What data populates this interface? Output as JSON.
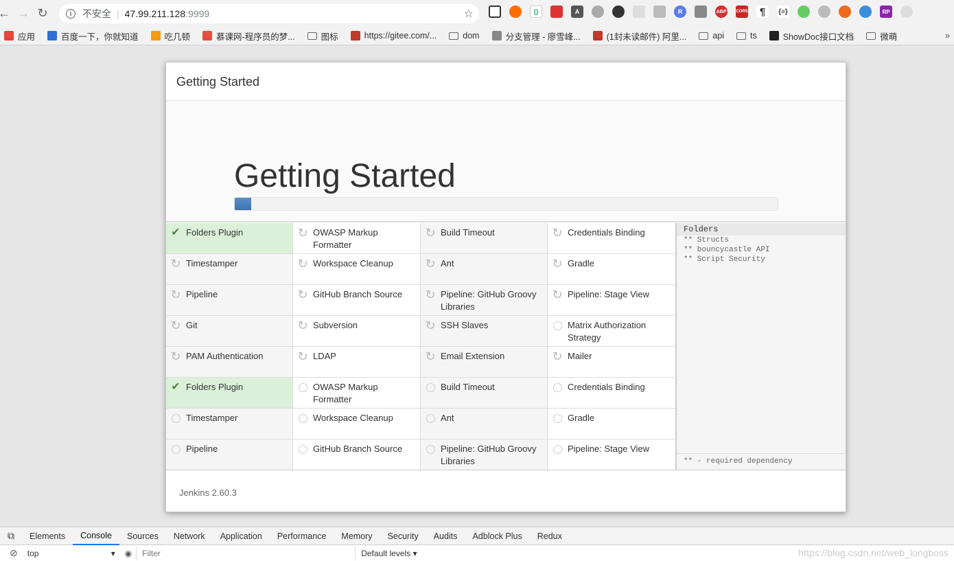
{
  "browser": {
    "security_label": "不安全",
    "url_host": "47.99.211.128",
    "url_port": ":9999",
    "bookmarks": [
      {
        "label": "应用",
        "color": "#e8453c"
      },
      {
        "label": "百度一下，你就知道",
        "color": "#2f6fd6"
      },
      {
        "label": "吃几顿",
        "color": "#f39c12"
      },
      {
        "label": "慕课网-程序员的梦...",
        "color": "#e74c3c"
      },
      {
        "label": "图标",
        "color": "folder"
      },
      {
        "label": "https://gitee.com/...",
        "color": "#c0392b"
      },
      {
        "label": "dom",
        "color": "folder"
      },
      {
        "label": "分支管理 - 廖雪峰...",
        "color": "#888"
      },
      {
        "label": "(1封未读邮件) 阿里...",
        "color": "#c0392b"
      },
      {
        "label": "api",
        "color": "folder"
      },
      {
        "label": "ts",
        "color": "folder"
      },
      {
        "label": "ShowDoc接口文档",
        "color": "#222"
      },
      {
        "label": "微萌",
        "color": "folder"
      }
    ],
    "overflow_label": "»"
  },
  "dialog": {
    "header_title": "Getting Started",
    "hero_title": "Getting Started",
    "progress_fraction": 0.03,
    "footer_version": "Jenkins 2.60.3"
  },
  "plugins": [
    {
      "name": "Folders Plugin",
      "status": "success"
    },
    {
      "name": "OWASP Markup Formatter",
      "status": "installing"
    },
    {
      "name": "Build Timeout",
      "status": "installing"
    },
    {
      "name": "Credentials Binding",
      "status": "installing"
    },
    {
      "name": "Timestamper",
      "status": "installing"
    },
    {
      "name": "Workspace Cleanup",
      "status": "installing"
    },
    {
      "name": "Ant",
      "status": "installing"
    },
    {
      "name": "Gradle",
      "status": "installing"
    },
    {
      "name": "Pipeline",
      "status": "installing"
    },
    {
      "name": "GitHub Branch Source",
      "status": "installing"
    },
    {
      "name": "Pipeline: GitHub Groovy Libraries",
      "status": "installing"
    },
    {
      "name": "Pipeline: Stage View",
      "status": "installing"
    },
    {
      "name": "Git",
      "status": "installing"
    },
    {
      "name": "Subversion",
      "status": "installing"
    },
    {
      "name": "SSH Slaves",
      "status": "installing"
    },
    {
      "name": "Matrix Authorization Strategy",
      "status": "pending"
    },
    {
      "name": "PAM Authentication",
      "status": "installing"
    },
    {
      "name": "LDAP",
      "status": "installing"
    },
    {
      "name": "Email Extension",
      "status": "installing"
    },
    {
      "name": "Mailer",
      "status": "installing"
    },
    {
      "name": "Folders Plugin",
      "status": "success"
    },
    {
      "name": "OWASP Markup Formatter",
      "status": "pending"
    },
    {
      "name": "Build Timeout",
      "status": "pending"
    },
    {
      "name": "Credentials Binding",
      "status": "pending"
    },
    {
      "name": "Timestamper",
      "status": "pending"
    },
    {
      "name": "Workspace Cleanup",
      "status": "pending"
    },
    {
      "name": "Ant",
      "status": "pending"
    },
    {
      "name": "Gradle",
      "status": "pending"
    },
    {
      "name": "Pipeline",
      "status": "pending"
    },
    {
      "name": "GitHub Branch Source",
      "status": "pending"
    },
    {
      "name": "Pipeline: GitHub Groovy Libraries",
      "status": "pending"
    },
    {
      "name": "Pipeline: Stage View",
      "status": "pending"
    }
  ],
  "install_log": {
    "current": "Folders",
    "dependencies": [
      "** Structs",
      "** bouncycastle API",
      "** Script Security"
    ],
    "legend": "** - required dependency"
  },
  "devtools": {
    "tabs": [
      "Elements",
      "Console",
      "Sources",
      "Network",
      "Application",
      "Performance",
      "Memory",
      "Security",
      "Audits",
      "Adblock Plus",
      "Redux"
    ],
    "active_tab": "Console",
    "context": "top",
    "filter_placeholder": "Filter",
    "levels_label": "Default levels ▾"
  },
  "watermark": "https://blog.csdn.net/web_longboss"
}
